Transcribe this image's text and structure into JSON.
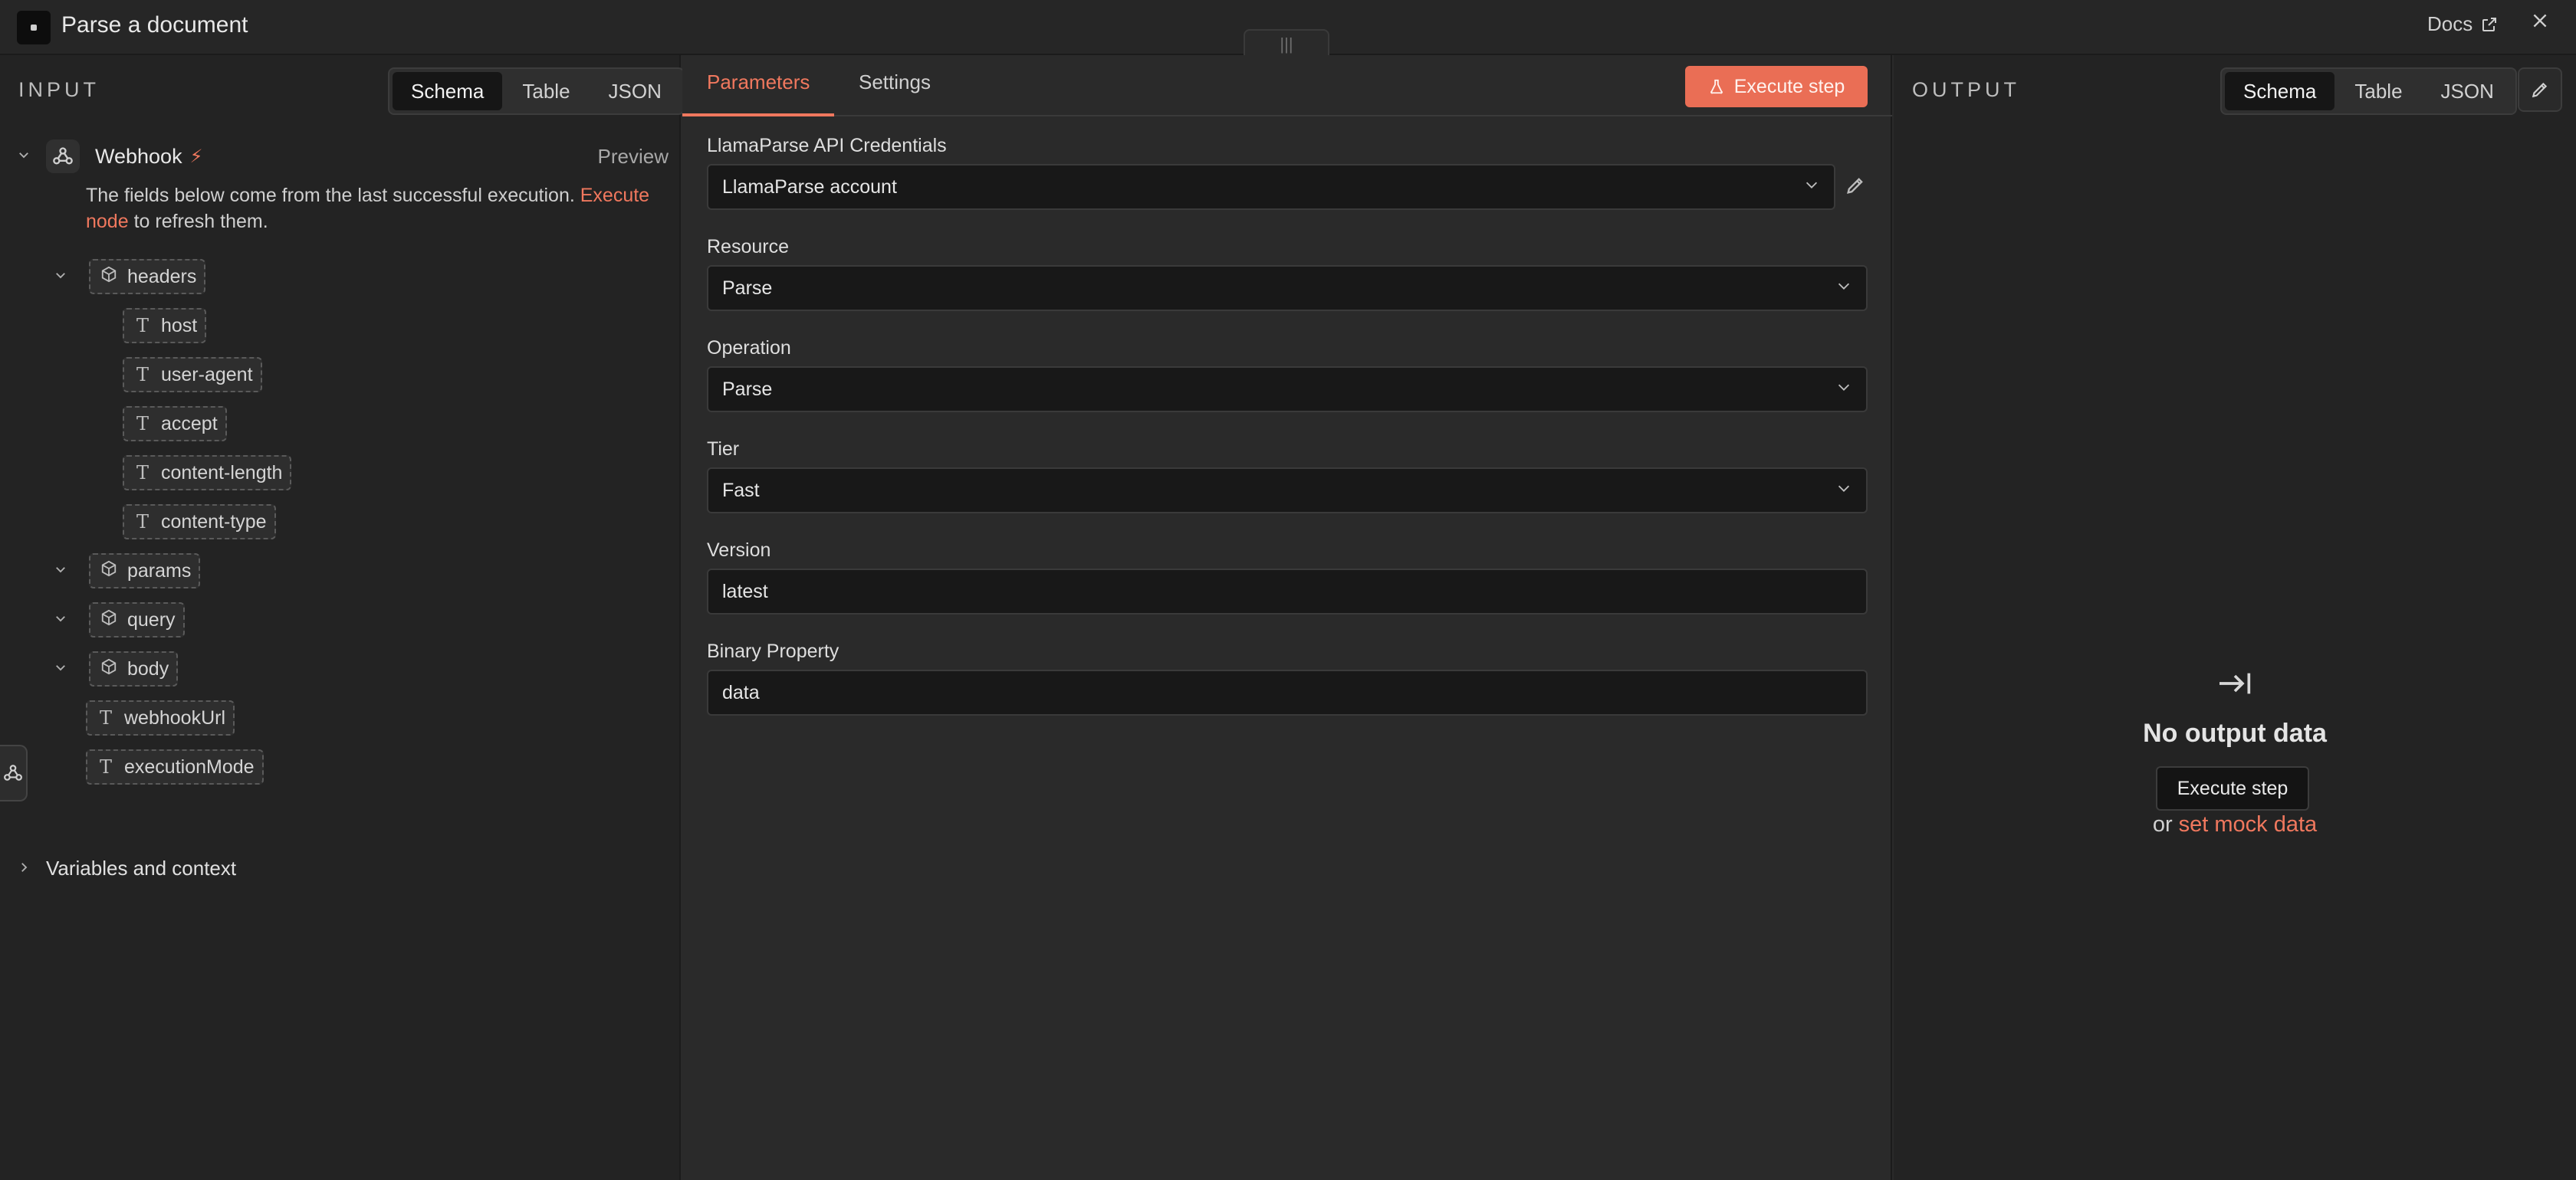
{
  "header": {
    "title": "Parse a document",
    "docs_label": "Docs",
    "drag_glyph": "|||"
  },
  "input": {
    "label": "INPUT",
    "view_tabs": [
      "Schema",
      "Table",
      "JSON"
    ],
    "node": {
      "name": "Webhook",
      "preview_label": "Preview"
    },
    "hint": {
      "text": "The fields below come from the last successful execution. ",
      "link": "Execute node",
      "suffix": " to refresh them."
    },
    "tree": {
      "headers": {
        "label": "headers",
        "children": [
          "host",
          "user-agent",
          "accept",
          "content-length",
          "content-type"
        ]
      },
      "params": "params",
      "query": "query",
      "body": "body",
      "webhookUrl": "webhookUrl",
      "executionMode": "executionMode"
    },
    "variables_label": "Variables and context"
  },
  "params": {
    "tabs": [
      "Parameters",
      "Settings"
    ],
    "execute_label": "Execute step",
    "fields": {
      "credentials": {
        "label": "LlamaParse API Credentials",
        "value": "LlamaParse account"
      },
      "resource": {
        "label": "Resource",
        "value": "Parse"
      },
      "operation": {
        "label": "Operation",
        "value": "Parse"
      },
      "tier": {
        "label": "Tier",
        "value": "Fast"
      },
      "version": {
        "label": "Version",
        "value": "latest"
      },
      "binary": {
        "label": "Binary Property",
        "value": "data"
      }
    }
  },
  "output": {
    "label": "OUTPUT",
    "view_tabs": [
      "Schema",
      "Table",
      "JSON"
    ],
    "empty_title": "No output data",
    "execute_label": "Execute step",
    "or_text": "or ",
    "mock_link": "set mock data"
  },
  "colors": {
    "accent": "#f0785e",
    "background": "#2a2a2a",
    "panel": "#232323",
    "field": "#181818"
  }
}
